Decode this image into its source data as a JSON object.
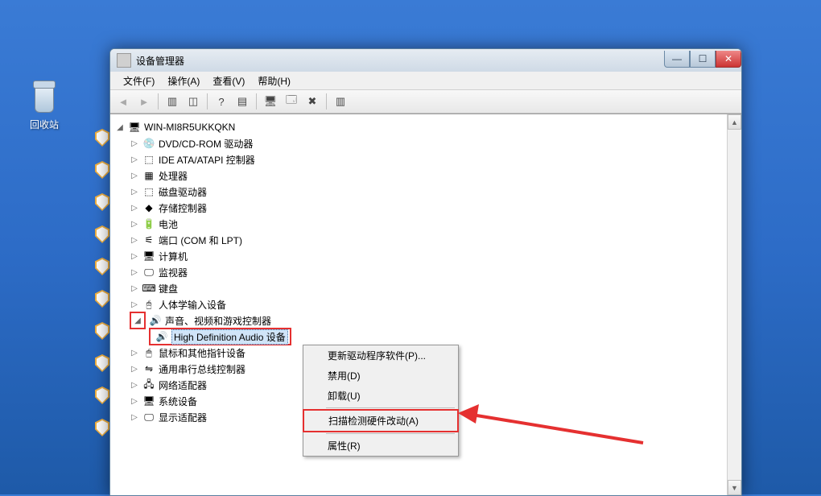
{
  "desktop": {
    "recycle_bin": "回收站"
  },
  "window": {
    "title": "设备管理器",
    "menu": {
      "file": "文件(F)",
      "action": "操作(A)",
      "view": "查看(V)",
      "help": "帮助(H)"
    },
    "root": "WIN-MI8R5UKKQKN",
    "nodes": {
      "dvd": "DVD/CD-ROM 驱动器",
      "ide": "IDE ATA/ATAPI 控制器",
      "cpu": "处理器",
      "disk": "磁盘驱动器",
      "storage": "存储控制器",
      "battery": "电池",
      "ports": "端口 (COM 和 LPT)",
      "computer": "计算机",
      "monitor": "监视器",
      "keyboard": "键盘",
      "hid": "人体学输入设备",
      "sound": "声音、视频和游戏控制器",
      "sound_child": "High Definition Audio 设备",
      "mouse": "鼠标和其他指针设备",
      "usb": "通用串行总线控制器",
      "network": "网络适配器",
      "system": "系统设备",
      "display": "显示适配器"
    }
  },
  "context_menu": {
    "update": "更新驱动程序软件(P)...",
    "disable": "禁用(D)",
    "uninstall": "卸载(U)",
    "scan": "扫描检测硬件改动(A)",
    "properties": "属性(R)"
  }
}
